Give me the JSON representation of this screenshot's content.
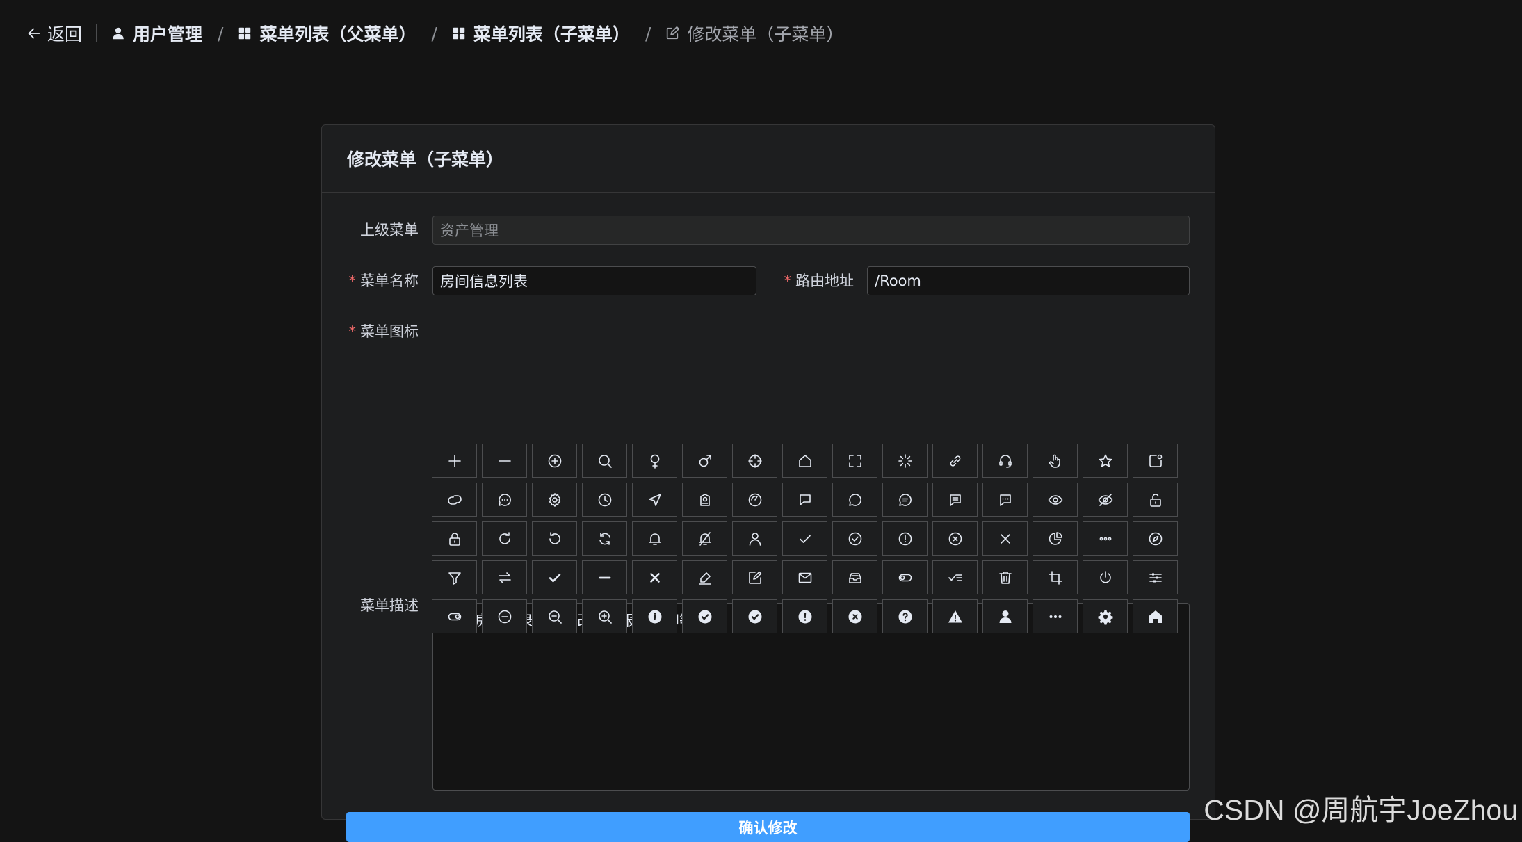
{
  "breadcrumb": {
    "back_label": "返回",
    "items": [
      {
        "label": "用户管理",
        "icon": "user-icon"
      },
      {
        "label": "菜单列表（父菜单）",
        "icon": "grid-icon"
      },
      {
        "label": "菜单列表（子菜单）",
        "icon": "grid-icon"
      },
      {
        "label": "修改菜单（子菜单）",
        "icon": "edit-icon"
      }
    ],
    "separator": "/"
  },
  "card": {
    "title": "修改菜单（子菜单）"
  },
  "form": {
    "parent_menu": {
      "label": "上级菜单",
      "value": "资产管理"
    },
    "menu_name": {
      "label": "菜单名称",
      "value": "房间信息列表"
    },
    "route": {
      "label": "路由地址",
      "value": "/Room"
    },
    "menu_icon": {
      "label": "菜单图标"
    },
    "description": {
      "label": "菜单描述",
      "value": "包括房间记录的增删改查，报表打印等。"
    },
    "required_mark": "*",
    "submit_label": "确认修改"
  },
  "icons": [
    "plus",
    "minus",
    "circle-plus",
    "search",
    "female",
    "male",
    "aim",
    "house",
    "full-screen",
    "loading",
    "link",
    "service",
    "pointer",
    "star",
    "notification",
    "connection",
    "chat-dot-round",
    "setting",
    "clock",
    "position",
    "postcard",
    "odometer",
    "chat-square",
    "chat-round",
    "chat-line-round",
    "chat-line-square",
    "chat-dot-square",
    "view",
    "hide",
    "unlock",
    "lock",
    "refresh-right",
    "refresh-left",
    "refresh",
    "bell",
    "mute-notification",
    "user",
    "check",
    "circle-check",
    "warning",
    "circle-close",
    "close",
    "pie-chart",
    "more",
    "compass",
    "filter",
    "switch",
    "select",
    "semi-select",
    "close-bold",
    "edit-pen",
    "edit",
    "message",
    "message-box",
    "turn-off",
    "finished",
    "delete",
    "crop",
    "switch-button",
    "operation",
    "open",
    "remove",
    "zoom-out",
    "zoom-in",
    "info-filled",
    "circle-check-filled",
    "success-filled",
    "warning-filled",
    "circle-close-filled",
    "question-filled",
    "warn-triangle-filled",
    "user-filled",
    "more-filled",
    "tools",
    "home-filled"
  ],
  "watermark": "CSDN @周航宇JoeZhou",
  "colors": {
    "background": "#141414",
    "card": "#1d1e1f",
    "border": "#4c4d4f",
    "primary": "#409eff",
    "required": "#f56c6c"
  }
}
